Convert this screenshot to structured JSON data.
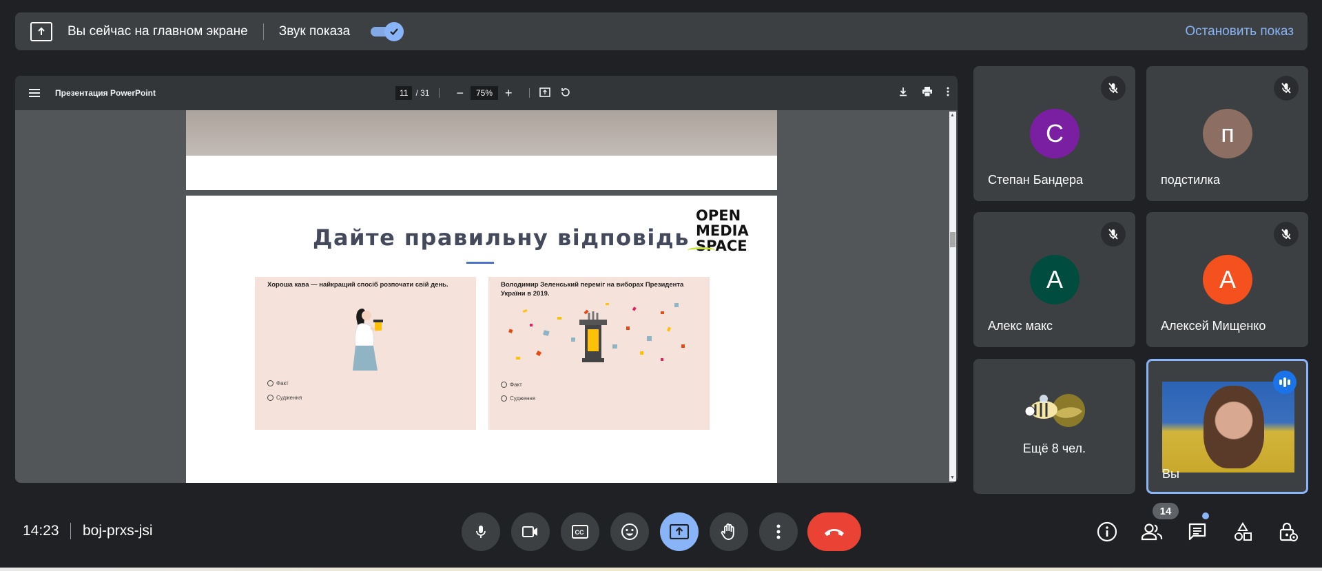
{
  "banner": {
    "status_text": "Вы сейчас на главном экране",
    "audio_label": "Звук показа",
    "audio_enabled": true,
    "stop_label": "Остановить показ"
  },
  "viewer": {
    "title": "Презентация PowerPoint",
    "page_current": "11",
    "page_total": "/ 31",
    "zoom": "75%",
    "zoom_out": "−",
    "zoom_in": "+"
  },
  "slide": {
    "title": "Дайте правильну відповідь",
    "logo_lines": [
      "OPEN",
      "MEDIA",
      "SPACE"
    ],
    "cards": [
      {
        "question": "Хороша кава — найкращий спосіб розпочати свій день.",
        "options": [
          "Факт",
          "Судження"
        ]
      },
      {
        "question": "Володимир Зеленський переміг на виборах Президента України в 2019.",
        "options": [
          "Факт",
          "Судження"
        ]
      }
    ]
  },
  "participants": [
    {
      "initial": "С",
      "name": "Степан Бандера",
      "color": "#7b1fa2",
      "muted": true
    },
    {
      "initial": "п",
      "name": "подстилка",
      "color": "#8d6e63",
      "muted": true
    },
    {
      "initial": "А",
      "name": "Алекс макс",
      "color": "#004d40",
      "muted": true
    },
    {
      "initial": "А",
      "name": "Алексей Мищенко",
      "color": "#f4511e",
      "muted": true
    }
  ],
  "more_participants": "Ещё 8 чел.",
  "self_tile": {
    "name": "Вы",
    "speaking": true
  },
  "footer": {
    "time": "14:23",
    "meeting_code": "boj-prxs-jsi",
    "participant_count": "14"
  },
  "icons": [
    "present-screen-icon",
    "check-icon",
    "menu-icon",
    "fit-page-icon",
    "rotate-icon",
    "download-icon",
    "print-icon",
    "more-vert-icon",
    "mic-off-icon",
    "mic-icon",
    "camera-icon",
    "captions-icon",
    "emoji-icon",
    "present-icon",
    "raise-hand-icon",
    "more-options-icon",
    "end-call-icon",
    "info-icon",
    "people-icon",
    "chat-icon",
    "activities-icon",
    "host-controls-icon"
  ],
  "colors": {
    "accent": "#8ab4f8",
    "leave": "#ea4335",
    "surface": "#3c4043",
    "background": "#202124"
  }
}
